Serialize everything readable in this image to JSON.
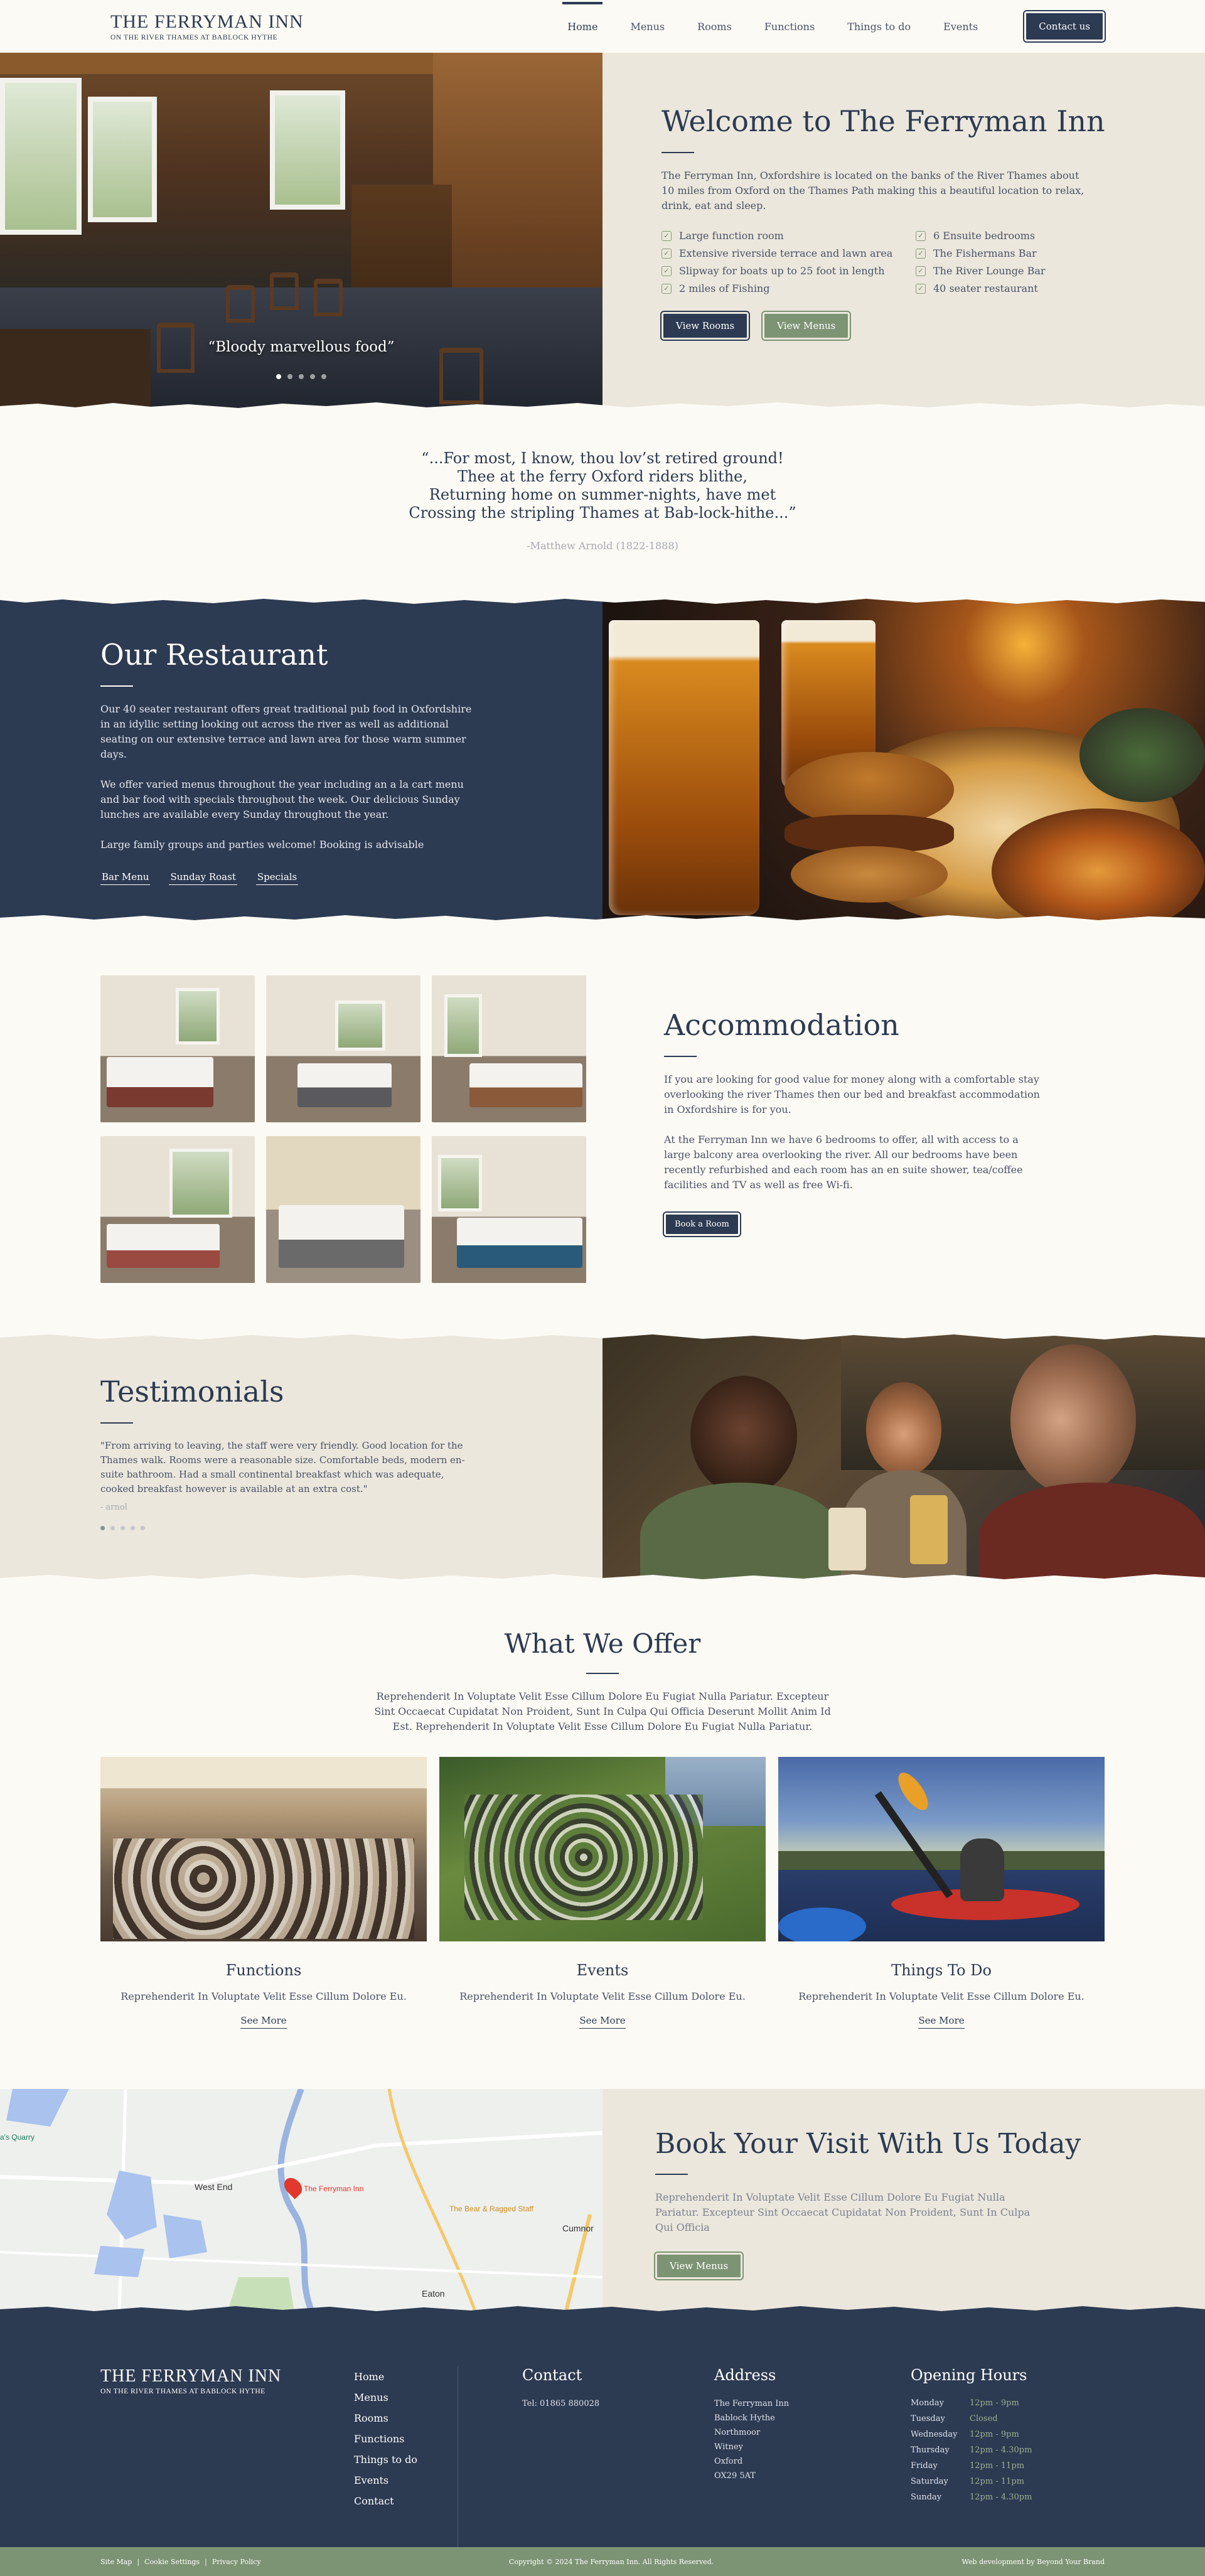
{
  "brand": {
    "name": "THE FERRYMAN INN",
    "tagline": "ON THE RIVER THAMES AT BABLOCK HYTHE"
  },
  "nav": {
    "items": [
      {
        "label": "Home",
        "active": true
      },
      {
        "label": "Menus"
      },
      {
        "label": "Rooms"
      },
      {
        "label": "Functions"
      },
      {
        "label": "Things to do"
      },
      {
        "label": "Events"
      }
    ],
    "contact_label": "Contact us"
  },
  "hero": {
    "caption": "“Bloody marvellous food”",
    "slide_count": 5,
    "active_slide": 1,
    "title": "Welcome to The Ferryman Inn",
    "intro": "The Ferryman Inn, Oxfordshire is located on the banks of the River  Thames about 10 miles from Oxford on the Thames Path making this a  beautiful location to relax, drink, eat and sleep.",
    "features": [
      "Large function room",
      "6 Ensuite bedrooms",
      "Extensive riverside terrace and lawn area",
      "The Fishermans Bar",
      "Slipway for boats up to 25 foot in length",
      "The River Lounge Bar",
      "2 miles of Fishing",
      "40 seater restaurant"
    ],
    "btn_rooms": "View Rooms",
    "btn_menus": "View Menus"
  },
  "poem": {
    "lines": [
      "“...For most, I know, thou lov’st retired ground!",
      "Thee at the ferry Oxford riders blithe,",
      "Returning home on summer-nights, have met",
      "Crossing the stripling Thames at Bab-lock-hithe...”"
    ],
    "author": "-Matthew Arnold (1822-1888)"
  },
  "restaurant": {
    "title": "Our Restaurant",
    "p1": "Our 40 seater restaurant offers great traditional pub food in  Oxfordshire in an idyllic setting looking out across the river as well  as additional seating on our extensive terrace and lawn area for those  warm summer days.",
    "p2": "We offer varied menus throughout the year including an a la cart menu and bar food with specials throughout the week.  Our delicious Sunday lunches are available every Sunday throughout the year.",
    "p3": "Large family groups and parties welcome! Booking is advisable",
    "links": [
      "Bar Menu",
      "Sunday Roast",
      "Specials"
    ]
  },
  "accommodation": {
    "title": "Accommodation",
    "p1": "If you are looking for good value for  money along with a comfortable stay overlooking the river Thames then  our bed and breakfast accommodation in Oxfordshire is for you.",
    "p2": "At the Ferryman Inn we have 6 bedrooms to  offer, all with access to a large balcony area overlooking the river.  All our bedrooms have been recently refurbished and each room has an en  suite shower, tea/coffee facilities and TV as well as free Wi-fi.",
    "book_label": "Book a Room"
  },
  "testimonials": {
    "title": "Testimonials",
    "quote": "\"From arriving to leaving, the staff were very friendly. Good location for  the Thames walk. Rooms were a reasonable size. Comfortable beds, modern en-suite bathroom. Had a small continental breakfast which was adequate, cooked breakfast however is available at an extra cost.\"",
    "author": "- arnol",
    "slide_count": 5,
    "active_slide": 1
  },
  "offer": {
    "title": "What We Offer",
    "intro": "Reprehenderit In Voluptate Velit Esse Cillum Dolore Eu Fugiat Nulla Pariatur. Excepteur Sint Occaecat Cupidatat Non Proident, Sunt In Culpa Qui Officia Deserunt Mollit Anim Id Est. Reprehenderit In Voluptate Velit Esse Cillum Dolore Eu Fugiat Nulla Pariatur.",
    "cards": [
      {
        "title": "Functions",
        "desc": "Reprehenderit In Voluptate Velit Esse Cillum Dolore Eu.",
        "more": "See More"
      },
      {
        "title": "Events",
        "desc": "Reprehenderit In Voluptate Velit Esse Cillum Dolore Eu.",
        "more": "See More"
      },
      {
        "title": "Things To Do",
        "desc": "Reprehenderit In Voluptate Velit Esse Cillum Dolore Eu.",
        "more": "See More"
      }
    ]
  },
  "book": {
    "map": {
      "place": "The Ferryman Inn",
      "village1": "West End",
      "village2": "Cumnor",
      "village3": "Eaton",
      "poi": "The Bear & Ragged Staff",
      "poi2": "a's Quarry"
    },
    "title": "Book Your Visit With Us Today",
    "text": "Reprehenderit In Voluptate Velit Esse Cillum Dolore Eu Fugiat Nulla Pariatur. Excepteur Sint Occaecat Cupidatat Non Proident, Sunt In Culpa Qui Officia",
    "btn": "View Menus"
  },
  "footer": {
    "brand": "THE FERRYMAN INN",
    "tagline": "ON THE RIVER THAMES AT BABLOCK HYTHE",
    "nav": [
      "Home",
      "Menus",
      "Rooms",
      "Functions",
      "Things to do",
      "Events",
      "Contact"
    ],
    "contact_title": "Contact",
    "phone": "Tel: 01865 880028",
    "address_title": "Address",
    "address": [
      "The Ferryman Inn",
      "Bablock Hythe",
      "Northmoor",
      "Witney",
      "Oxford",
      "OX29 5AT"
    ],
    "hours_title": "Opening Hours",
    "hours": [
      {
        "day": "Monday",
        "time": "12pm - 9pm"
      },
      {
        "day": "Tuesday",
        "time": "Closed"
      },
      {
        "day": "Wednesday",
        "time": "12pm - 9pm"
      },
      {
        "day": "Thursday",
        "time": "12pm - 4.30pm"
      },
      {
        "day": "Friday",
        "time": "12pm - 11pm"
      },
      {
        "day": "Saturday",
        "time": "12pm - 11pm"
      },
      {
        "day": "Sunday",
        "time": "12pm - 4.30pm"
      }
    ]
  },
  "subfooter": {
    "links": [
      "Site Map",
      "Cookie Settings",
      "Privacy Policy"
    ],
    "separator": "|",
    "copyright": "Copyright © 2024 The Ferryman Inn. All Rights Reserved.",
    "credit": "Web development by Beyond Your Brand"
  },
  "colors": {
    "navy": "#2c3a52",
    "sage": "#7d9474",
    "cream": "#fcfaf4",
    "stone": "#ebe7dc"
  }
}
